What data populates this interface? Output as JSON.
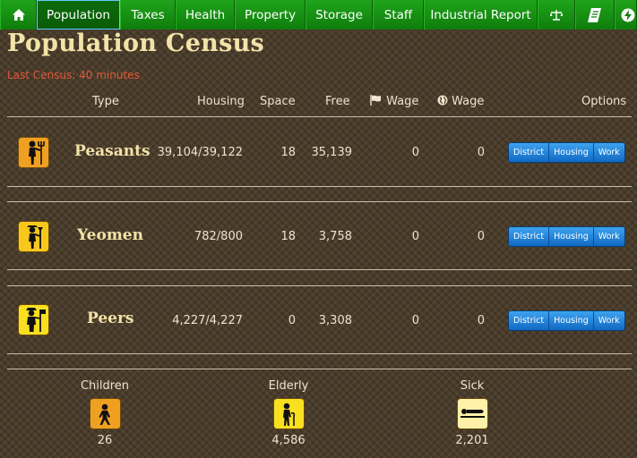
{
  "nav": {
    "tabs": [
      {
        "label": "",
        "icon": "home-icon"
      },
      {
        "label": "Population",
        "active": true
      },
      {
        "label": "Taxes"
      },
      {
        "label": "Health"
      },
      {
        "label": "Property"
      },
      {
        "label": "Storage"
      },
      {
        "label": "Staff"
      },
      {
        "label": "Industrial Report"
      },
      {
        "label": "",
        "icon": "scales-icon"
      },
      {
        "label": "",
        "icon": "scroll-icon"
      },
      {
        "label": "",
        "icon": "lightning-icon"
      }
    ]
  },
  "page": {
    "title": "Population Census",
    "last_census": "Last Census: 40 minutes"
  },
  "table": {
    "headers": {
      "type": "Type",
      "housing": "Housing",
      "space": "Space",
      "free": "Free",
      "wage_local": "Wage",
      "wage_global": "Wage",
      "options": "Options"
    },
    "header_icons": {
      "wage_local": "flag-icon",
      "wage_global": "globe-icon"
    },
    "rows": [
      {
        "name": "Peasants",
        "icon": "peasant-icon",
        "housing": "39,104/39,122",
        "space": "18",
        "free": "35,139",
        "wage_local": "0",
        "wage_global": "0"
      },
      {
        "name": "Yeomen",
        "icon": "yeoman-icon",
        "housing": "782/800",
        "space": "18",
        "free": "3,758",
        "wage_local": "0",
        "wage_global": "0"
      },
      {
        "name": "Peers",
        "icon": "peer-icon",
        "housing": "4,227/4,227",
        "space": "0",
        "free": "3,308",
        "wage_local": "0",
        "wage_global": "0"
      }
    ],
    "buttons": {
      "district": "District",
      "housing": "Housing",
      "work": "Work"
    }
  },
  "stats": [
    {
      "label": "Children",
      "value": "26",
      "icon": "child-icon"
    },
    {
      "label": "Elderly",
      "value": "4,586",
      "icon": "elderly-icon"
    },
    {
      "label": "Sick",
      "value": "2,201",
      "icon": "sick-icon"
    }
  ],
  "colors": {
    "nav_green": "#14901a",
    "accent_blue": "#1a7fd6",
    "warning_text": "#e0573a",
    "icon_orange": "#f0a020",
    "icon_yellow": "#f8d820"
  }
}
